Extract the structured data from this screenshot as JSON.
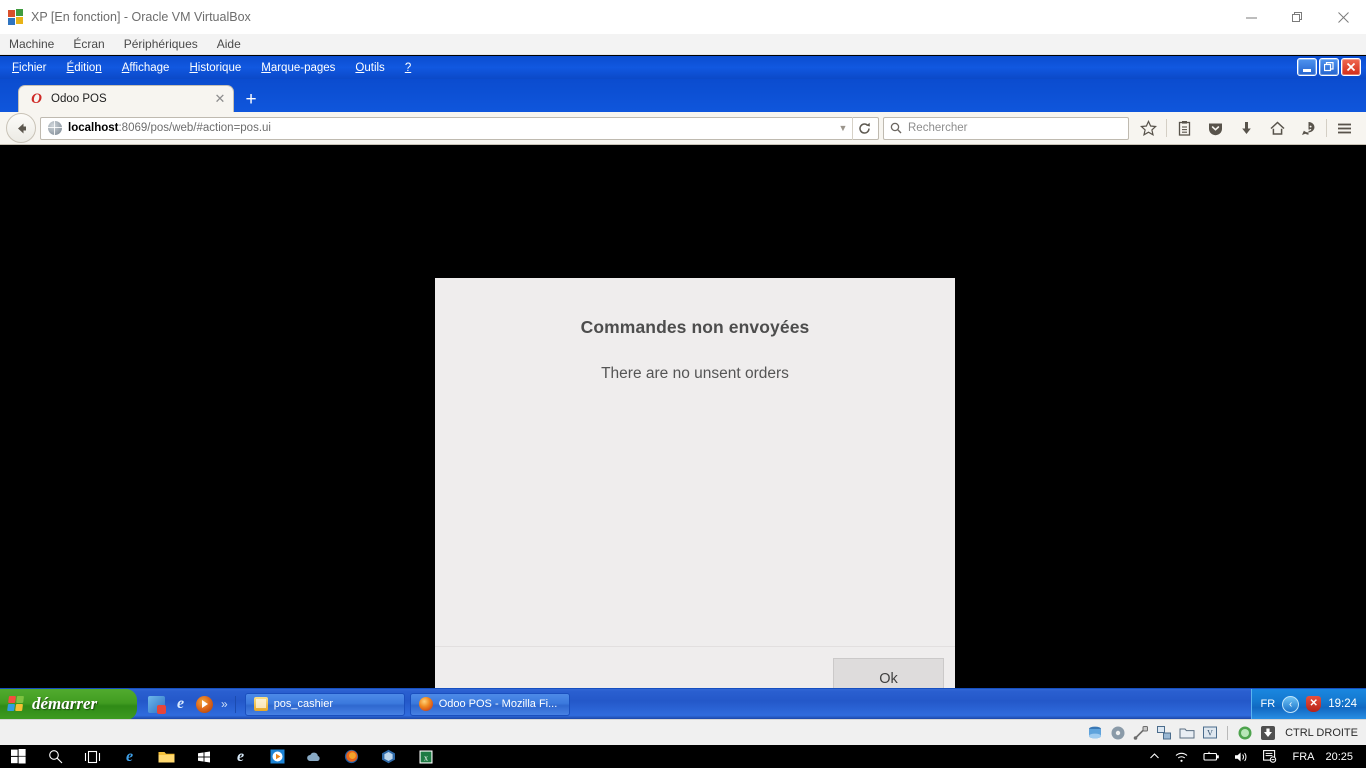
{
  "host_window": {
    "title": "XP [En fonction] - Oracle VM VirtualBox",
    "icon": "virtualbox-vm-icon",
    "menu": [
      "Machine",
      "Écran",
      "Périphériques",
      "Aide"
    ],
    "controls": {
      "minimize": "minimize-icon",
      "restore": "restore-icon",
      "close": "close-icon"
    }
  },
  "firefox": {
    "menu": [
      {
        "pre": "",
        "acc": "F",
        "post": "ichier"
      },
      {
        "pre": "",
        "acc": "É",
        "post": "ditio",
        "tail": "n"
      },
      {
        "pre": "",
        "acc": "A",
        "post": "ffichage"
      },
      {
        "pre": "",
        "acc": "H",
        "post": "istorique"
      },
      {
        "pre": "",
        "acc": "M",
        "post": "arque-pages"
      },
      {
        "pre": "",
        "acc": "O",
        "post": "utils"
      },
      {
        "pre": "",
        "acc": "?",
        "post": ""
      }
    ],
    "menu_labels": [
      "Fichier",
      "Édition",
      "Affichage",
      "Historique",
      "Marque-pages",
      "Outils",
      "?"
    ],
    "window_buttons": {
      "minimize": "_",
      "maximize": "□",
      "close": "✕"
    },
    "tab": {
      "title": "Odoo POS",
      "favicon": "O",
      "close_label": "✕"
    },
    "new_tab_label": "+",
    "url": {
      "host": "localhost",
      "path": ":8069/pos/web/#action=pos.ui",
      "full": "localhost:8069/pos/web/#action=pos.ui"
    },
    "search": {
      "placeholder": "Rechercher"
    },
    "toolbar_icons": [
      "bookmark-star-icon",
      "library-icon",
      "pocket-icon",
      "downloads-icon",
      "home-icon",
      "feedback-smiley-icon",
      "hamburger-menu-icon"
    ]
  },
  "modal": {
    "title": "Commandes non envoyées",
    "body": "There are no unsent orders",
    "ok_label": "Ok",
    "background": "#efeded"
  },
  "xp_taskbar": {
    "start_label": "démarrer",
    "quick_launch": [
      "show-desktop-icon",
      "internet-explorer-icon",
      "windows-media-player-icon"
    ],
    "quick_launch_more": "»",
    "tasks": [
      {
        "label": "pos_cashier",
        "icon": "folder-icon"
      },
      {
        "label": "Odoo POS - Mozilla Fi...",
        "icon": "firefox-icon"
      }
    ],
    "tray": {
      "language": "FR",
      "chevron": "‹",
      "shield": "security-alert-shield-icon",
      "time": "19:24"
    }
  },
  "vbox_status": {
    "icons": [
      "hard-disk-icon",
      "optical-disk-icon",
      "usb-icon",
      "network-icon",
      "shared-folder-icon",
      "display-capture-icon",
      "mouse-integration-icon",
      "host-key-icon"
    ],
    "host_key": "CTRL DROITE"
  },
  "host_taskbar": {
    "items": [
      "start-icon",
      "search-icon",
      "task-view-icon",
      "edge-icon",
      "file-explorer-icon",
      "microsoft-store-icon",
      "internet-explorer-icon",
      "media-player-icon",
      "weather-icon",
      "firefox-icon",
      "virtualbox-icon",
      "excel-icon"
    ],
    "tray": {
      "expand": "^",
      "icons": [
        "wifi-icon",
        "battery-icon",
        "volume-icon",
        "action-center-icon"
      ],
      "language": "FRA",
      "clock": "20:25"
    }
  }
}
